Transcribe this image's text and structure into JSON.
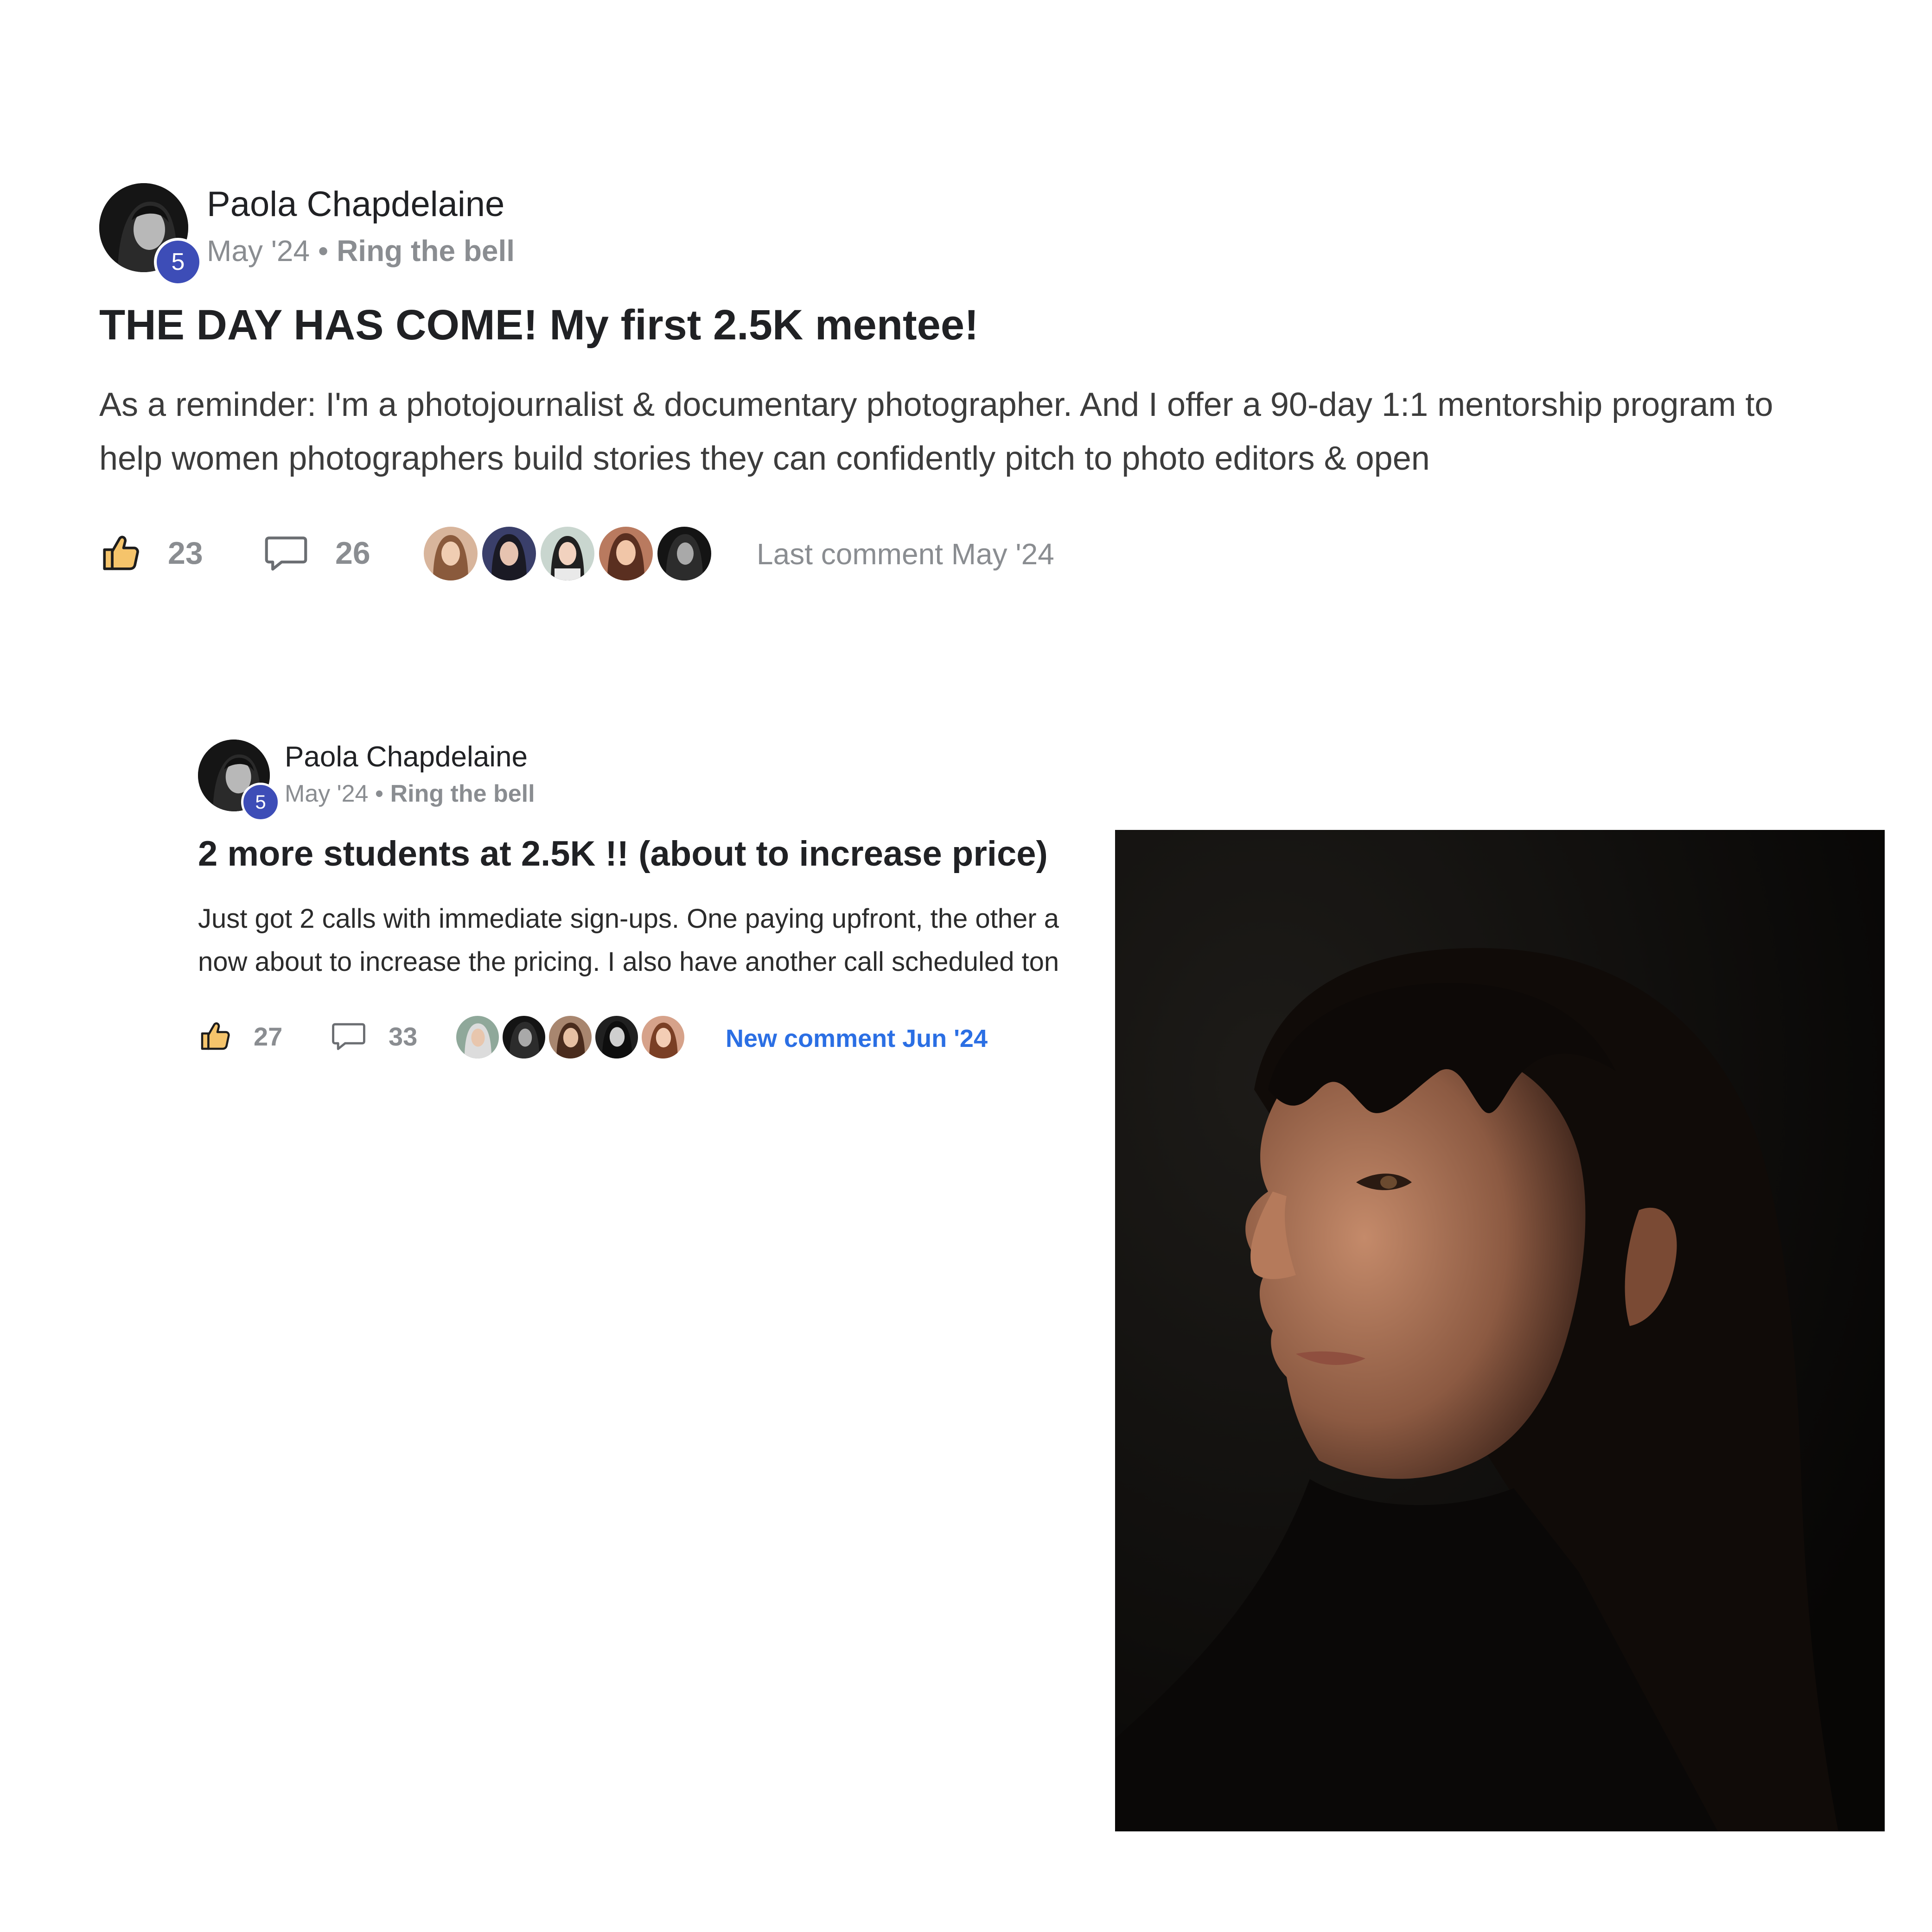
{
  "posts": [
    {
      "author": {
        "name": "Paola Chapdelaine",
        "level": "5"
      },
      "date": "May '24",
      "separator": "•",
      "category": "Ring the bell",
      "title": "THE DAY HAS COME! My first 2.5K mentee!",
      "excerpt": "As a reminder: I'm a photojournalist & documentary photographer. And I offer a 90-day 1:1 mentorship program to help women photographers build stories they can confidently pitch to photo editors & open",
      "likes": "23",
      "comments": "26",
      "activity": "Last comment May '24"
    },
    {
      "author": {
        "name": "Paola Chapdelaine",
        "level": "5"
      },
      "date": "May '24",
      "separator": "•",
      "category": "Ring the bell",
      "title": "2 more students at 2.5K !! (about to increase price)",
      "excerpt_lines": [
        "Just got 2 calls with immediate sign-ups. One paying upfront, the other a",
        "now about to increase the pricing. I also have another call scheduled ton"
      ],
      "likes": "27",
      "comments": "33",
      "activity": "New comment Jun '24"
    }
  ],
  "colors": {
    "badge": "#3d4db7",
    "muted": "#8a8d91",
    "link": "#2b6fe4",
    "like_icon_fill": "#f5c46b"
  },
  "icons": {
    "like": "thumbs-up-icon",
    "comment": "speech-bubble-icon"
  }
}
